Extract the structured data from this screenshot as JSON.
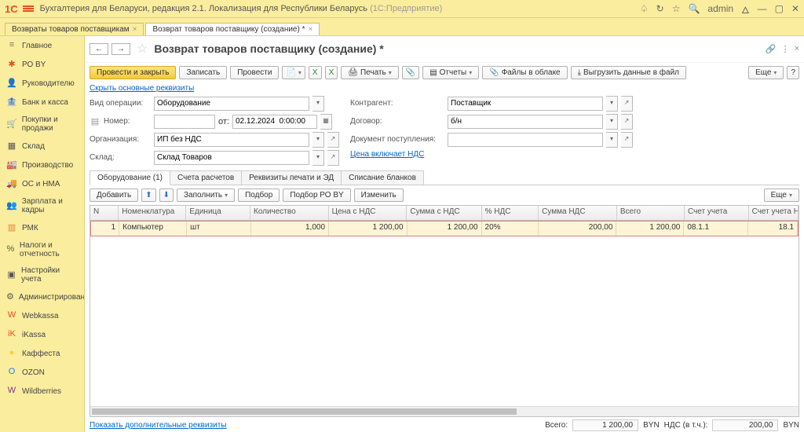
{
  "titlebar": {
    "app_title": "Бухгалтерия для Беларуси, редакция 2.1. Локализация для Республики Беларусь",
    "app_sub": "(1С:Предприятие)",
    "user": "admin"
  },
  "doctabs": [
    {
      "label": "Возвраты товаров поставщикам",
      "closable": true
    },
    {
      "label": "Возврат товаров поставщику (создание) *",
      "closable": true
    }
  ],
  "sidebar": [
    {
      "icon": "≡",
      "label": "Главное",
      "color": "#777"
    },
    {
      "icon": "✱",
      "label": "РО BY",
      "color": "#e84e1c"
    },
    {
      "icon": "👤",
      "label": "Руководителю",
      "color": "#555"
    },
    {
      "icon": "🏦",
      "label": "Банк и касса",
      "color": "#555"
    },
    {
      "icon": "🛒",
      "label": "Покупки и продажи",
      "color": "#555"
    },
    {
      "icon": "▦",
      "label": "Склад",
      "color": "#555"
    },
    {
      "icon": "🏭",
      "label": "Производство",
      "color": "#555"
    },
    {
      "icon": "🚚",
      "label": "ОС и НМА",
      "color": "#555"
    },
    {
      "icon": "👥",
      "label": "Зарплата и кадры",
      "color": "#555"
    },
    {
      "icon": "▥",
      "label": "РМК",
      "color": "#e08030"
    },
    {
      "icon": "%",
      "label": "Налоги и отчетность",
      "color": "#555"
    },
    {
      "icon": "▣",
      "label": "Настройки учета",
      "color": "#555"
    },
    {
      "icon": "⚙",
      "label": "Администрирование",
      "color": "#555"
    },
    {
      "icon": "W",
      "label": "Webkassa",
      "color": "#e84e1c"
    },
    {
      "icon": "iK",
      "label": "iKassa",
      "color": "#e84e1c"
    },
    {
      "icon": "●",
      "label": "Каффеста",
      "color": "#f5d040"
    },
    {
      "icon": "O",
      "label": "OZON",
      "color": "#2a7de0"
    },
    {
      "icon": "W",
      "label": "Wildberries",
      "color": "#8030a0"
    }
  ],
  "page": {
    "title": "Возврат товаров поставщику (создание) *"
  },
  "toolbar": {
    "post_close": "Провести и закрыть",
    "write": "Записать",
    "post": "Провести",
    "print": "Печать",
    "reports": "Отчеты",
    "files": "Файлы в облаке",
    "export": "Выгрузить данные в файл",
    "more": "Еще"
  },
  "links": {
    "hide_main": "Скрыть основные реквизиты",
    "vat_price": "Цена включает НДС",
    "show_extra": "Показать дополнительные реквизиты"
  },
  "form": {
    "op_label": "Вид операции:",
    "op_value": "Оборудование",
    "num_label": "Номер:",
    "num_value": "",
    "date_label": "от:",
    "date_value": "02.12.2024  0:00:00",
    "org_label": "Организация:",
    "org_value": "ИП без НДС",
    "stock_label": "Склад:",
    "stock_value": "Склад Товаров",
    "agent_label": "Контрагент:",
    "agent_value": "Поставщик",
    "contract_label": "Договор:",
    "contract_value": "б/н",
    "doc_label": "Документ поступления:",
    "doc_value": ""
  },
  "tabs2": [
    {
      "label": "Оборудование (1)",
      "active": true
    },
    {
      "label": "Счета расчетов"
    },
    {
      "label": "Реквизиты печати и ЭД"
    },
    {
      "label": "Списание бланков"
    }
  ],
  "subtoolbar": {
    "add": "Добавить",
    "fill": "Заполнить",
    "pick": "Подбор",
    "pickro": "Подбор РО BY",
    "edit": "Изменить",
    "more": "Еще"
  },
  "grid": {
    "headers": [
      "N",
      "Номенклатура",
      "Единица",
      "Количество",
      "Цена с НДС",
      "Сумма с НДС",
      "% НДС",
      "Сумма НДС",
      "Всего",
      "Счет учета",
      "Счет учета НДС"
    ],
    "rows": [
      {
        "n": "1",
        "nom": "Компьютер",
        "unit": "шт",
        "qty": "1,000",
        "price": "1 200,00",
        "sum": "1 200,00",
        "vat": "20%",
        "vatsum": "200,00",
        "total": "1 200,00",
        "acc": "08.1.1",
        "accvat": "18.1"
      }
    ]
  },
  "footer": {
    "total_label": "Всего:",
    "total": "1 200,00",
    "cur": "BYN",
    "vat_label": "НДС (в т.ч.):",
    "vat": "200,00"
  }
}
